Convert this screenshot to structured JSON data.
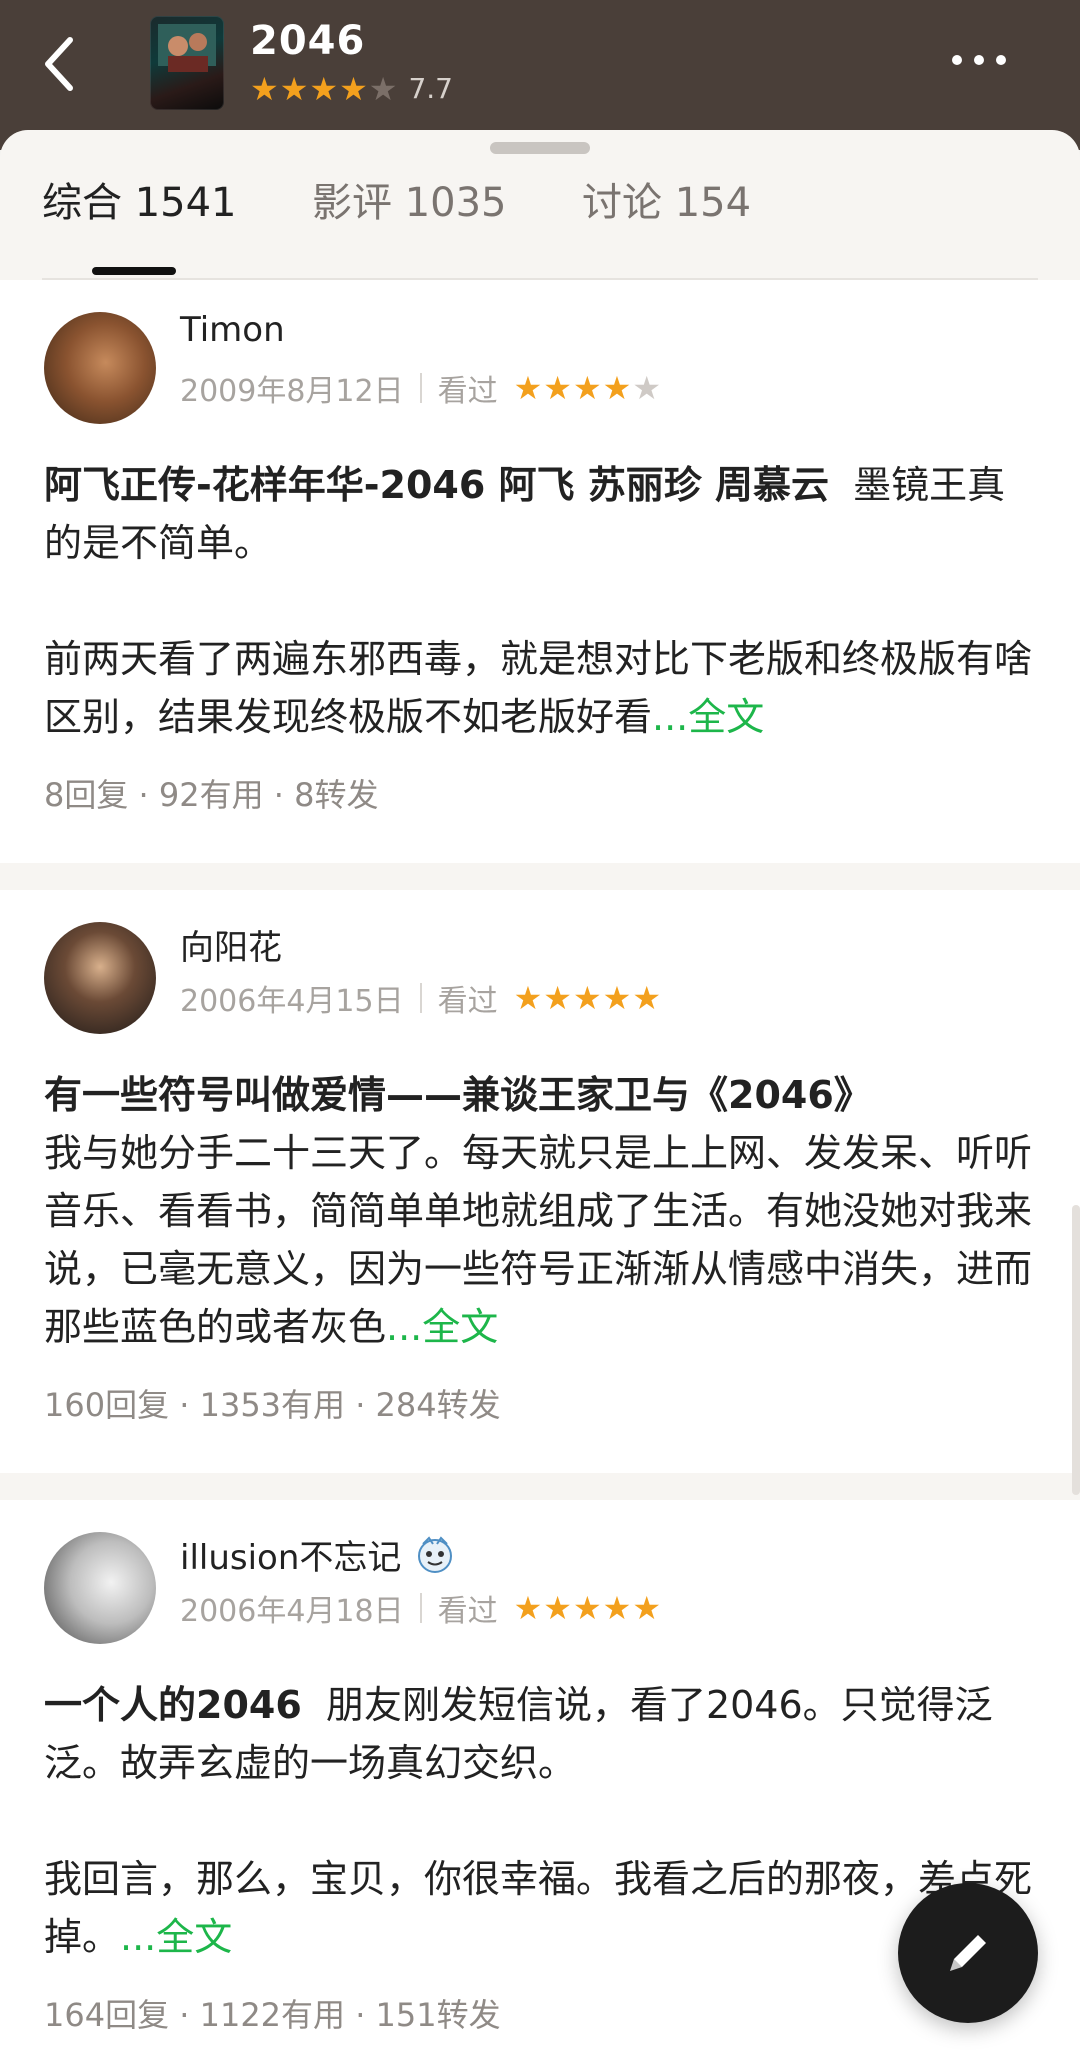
{
  "header": {
    "title": "2046",
    "score": "7.7",
    "stars": [
      "on",
      "on",
      "on",
      "on",
      "off"
    ]
  },
  "tabs": [
    {
      "label": "综合 1541",
      "active": true
    },
    {
      "label": "影评 1035",
      "active": false
    },
    {
      "label": "讨论 154",
      "active": false
    }
  ],
  "reviews": [
    {
      "author": "Timon",
      "date": "2009年8月12日",
      "status": "看过",
      "stars": [
        "on",
        "on",
        "on",
        "on",
        "off"
      ],
      "headline": "阿飞正传-花样年华-2046 阿飞 苏丽珍 周慕云",
      "intro": "墨镜王真的是不简单。",
      "excerpt": "前两天看了两遍东邪西毒，就是想对比下老版和终极版有啥区别，结果发现终极版不如老版好看",
      "more": "...全文",
      "stats": "8回复 · 92有用 · 8转发"
    },
    {
      "author": "向阳花",
      "date": "2006年4月15日",
      "status": "看过",
      "stars": [
        "on",
        "on",
        "on",
        "on",
        "on"
      ],
      "headline": "有一些符号叫做爱情——兼谈王家卫与《2046》",
      "excerpt": "我与她分手二十三天了。每天就只是上上网、发发呆、听听音乐、看看书，简简单单地就组成了生活。有她没她对我来说，已毫无意义，因为一些符号正渐渐从情感中消失，进而那些蓝色的或者灰色",
      "more": "...全文",
      "stats": "160回复 · 1353有用 · 284转发"
    },
    {
      "author": "illusion不忘记",
      "date": "2006年4月18日",
      "status": "看过",
      "stars": [
        "on",
        "on",
        "on",
        "on",
        "on"
      ],
      "headline": "一个人的2046",
      "intro": "朋友刚发短信说，看了2046。只觉得泛泛。故弄玄虚的一场真幻交织。",
      "excerpt": "我回言，那么，宝贝，你很幸福。我看之后的那夜，差点死掉。",
      "more": "...全文",
      "stats": "164回复 · 1122有用 · 151转发"
    }
  ]
}
